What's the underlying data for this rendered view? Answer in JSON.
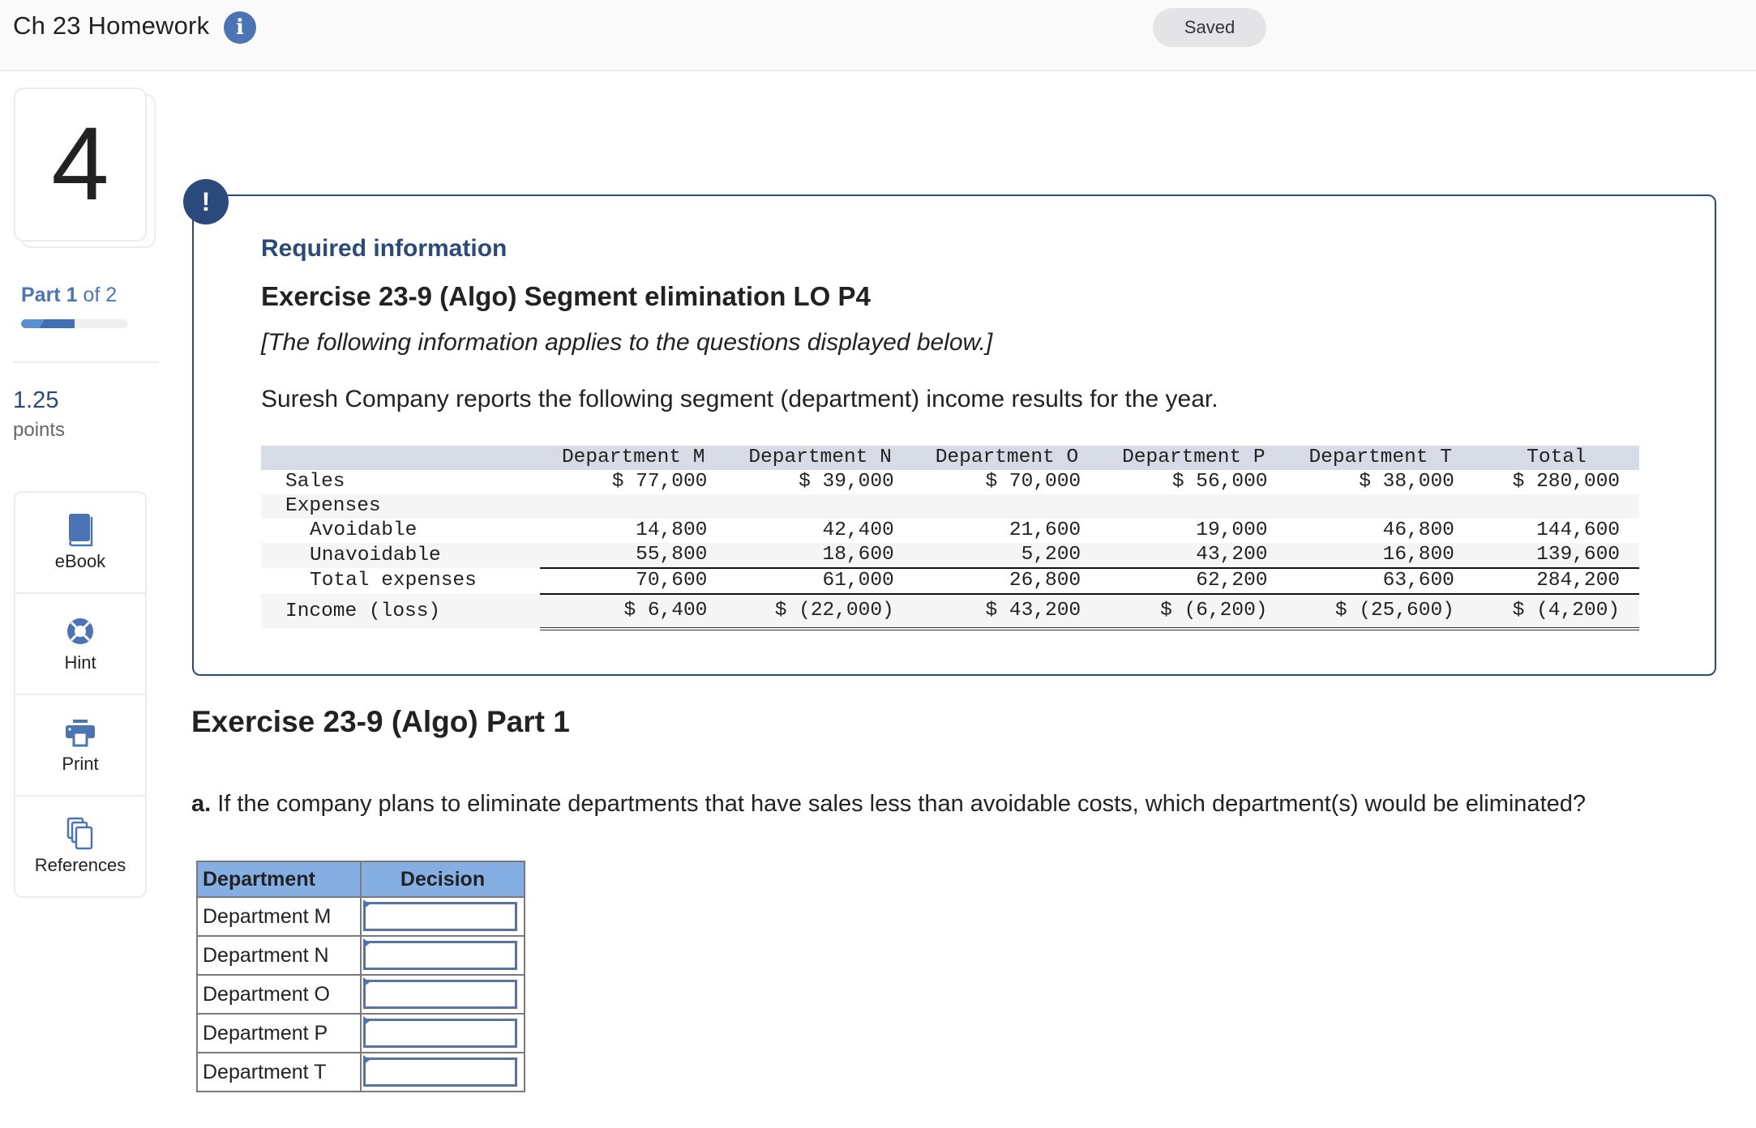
{
  "header": {
    "title": "Ch 23 Homework",
    "info_icon": "info-icon",
    "status": "Saved"
  },
  "sidebar": {
    "question_number": "4",
    "part_current": "Part 1",
    "part_total": " of 2",
    "progress_fraction": 0.5,
    "points_value": "1.25",
    "points_label": "points",
    "tools": [
      {
        "label": "eBook",
        "icon": "book-icon"
      },
      {
        "label": "Hint",
        "icon": "lifebuoy-icon"
      },
      {
        "label": "Print",
        "icon": "printer-icon"
      },
      {
        "label": "References",
        "icon": "documents-icon"
      }
    ]
  },
  "required_info": {
    "alert_icon": "!",
    "heading": "Required information",
    "exercise_title": "Exercise 23-9 (Algo) Segment elimination LO P4",
    "note": "[The following information applies to the questions displayed below.]",
    "intro": "Suresh Company reports the following segment (department) income results for the year.",
    "table": {
      "columns": [
        "",
        "Department M",
        "Department N",
        "Department O",
        "Department P",
        "Department T",
        "Total"
      ],
      "rows": [
        {
          "label": "Sales",
          "values": [
            "$ 77,000",
            "$ 39,000",
            "$ 70,000",
            "$ 56,000",
            "$ 38,000",
            "$ 280,000"
          ]
        },
        {
          "label": "Expenses",
          "values": [
            "",
            "",
            "",
            "",
            "",
            ""
          ]
        },
        {
          "label": "Avoidable",
          "values": [
            "14,800",
            "42,400",
            "21,600",
            "19,000",
            "46,800",
            "144,600"
          ]
        },
        {
          "label": "Unavoidable",
          "values": [
            "55,800",
            "18,600",
            "5,200",
            "43,200",
            "16,800",
            "139,600"
          ]
        },
        {
          "label": "Total expenses",
          "values": [
            "70,600",
            "61,000",
            "26,800",
            "62,200",
            "63,600",
            "284,200"
          ]
        },
        {
          "label": "Income (loss)",
          "values": [
            "$ 6,400",
            "$ (22,000)",
            "$ 43,200",
            "$ (6,200)",
            "$ (25,600)",
            "$ (4,200)"
          ]
        }
      ]
    }
  },
  "part": {
    "title": "Exercise 23-9 (Algo) Part 1",
    "question_prefix": "a.",
    "question_text": " If the company plans to eliminate departments that have sales less than avoidable costs, which department(s) would be eliminated?",
    "answer_table": {
      "headers": [
        "Department",
        "Decision"
      ],
      "rows": [
        {
          "department": "Department M",
          "decision": ""
        },
        {
          "department": "Department N",
          "decision": ""
        },
        {
          "department": "Department O",
          "decision": ""
        },
        {
          "department": "Department P",
          "decision": ""
        },
        {
          "department": "Department T",
          "decision": ""
        }
      ]
    }
  },
  "colors": {
    "brand_blue": "#4a74b4",
    "dark_blue": "#2b4a7c",
    "table_header_bg": "#d6dbe5",
    "answer_header_bg": "#85aee2"
  }
}
